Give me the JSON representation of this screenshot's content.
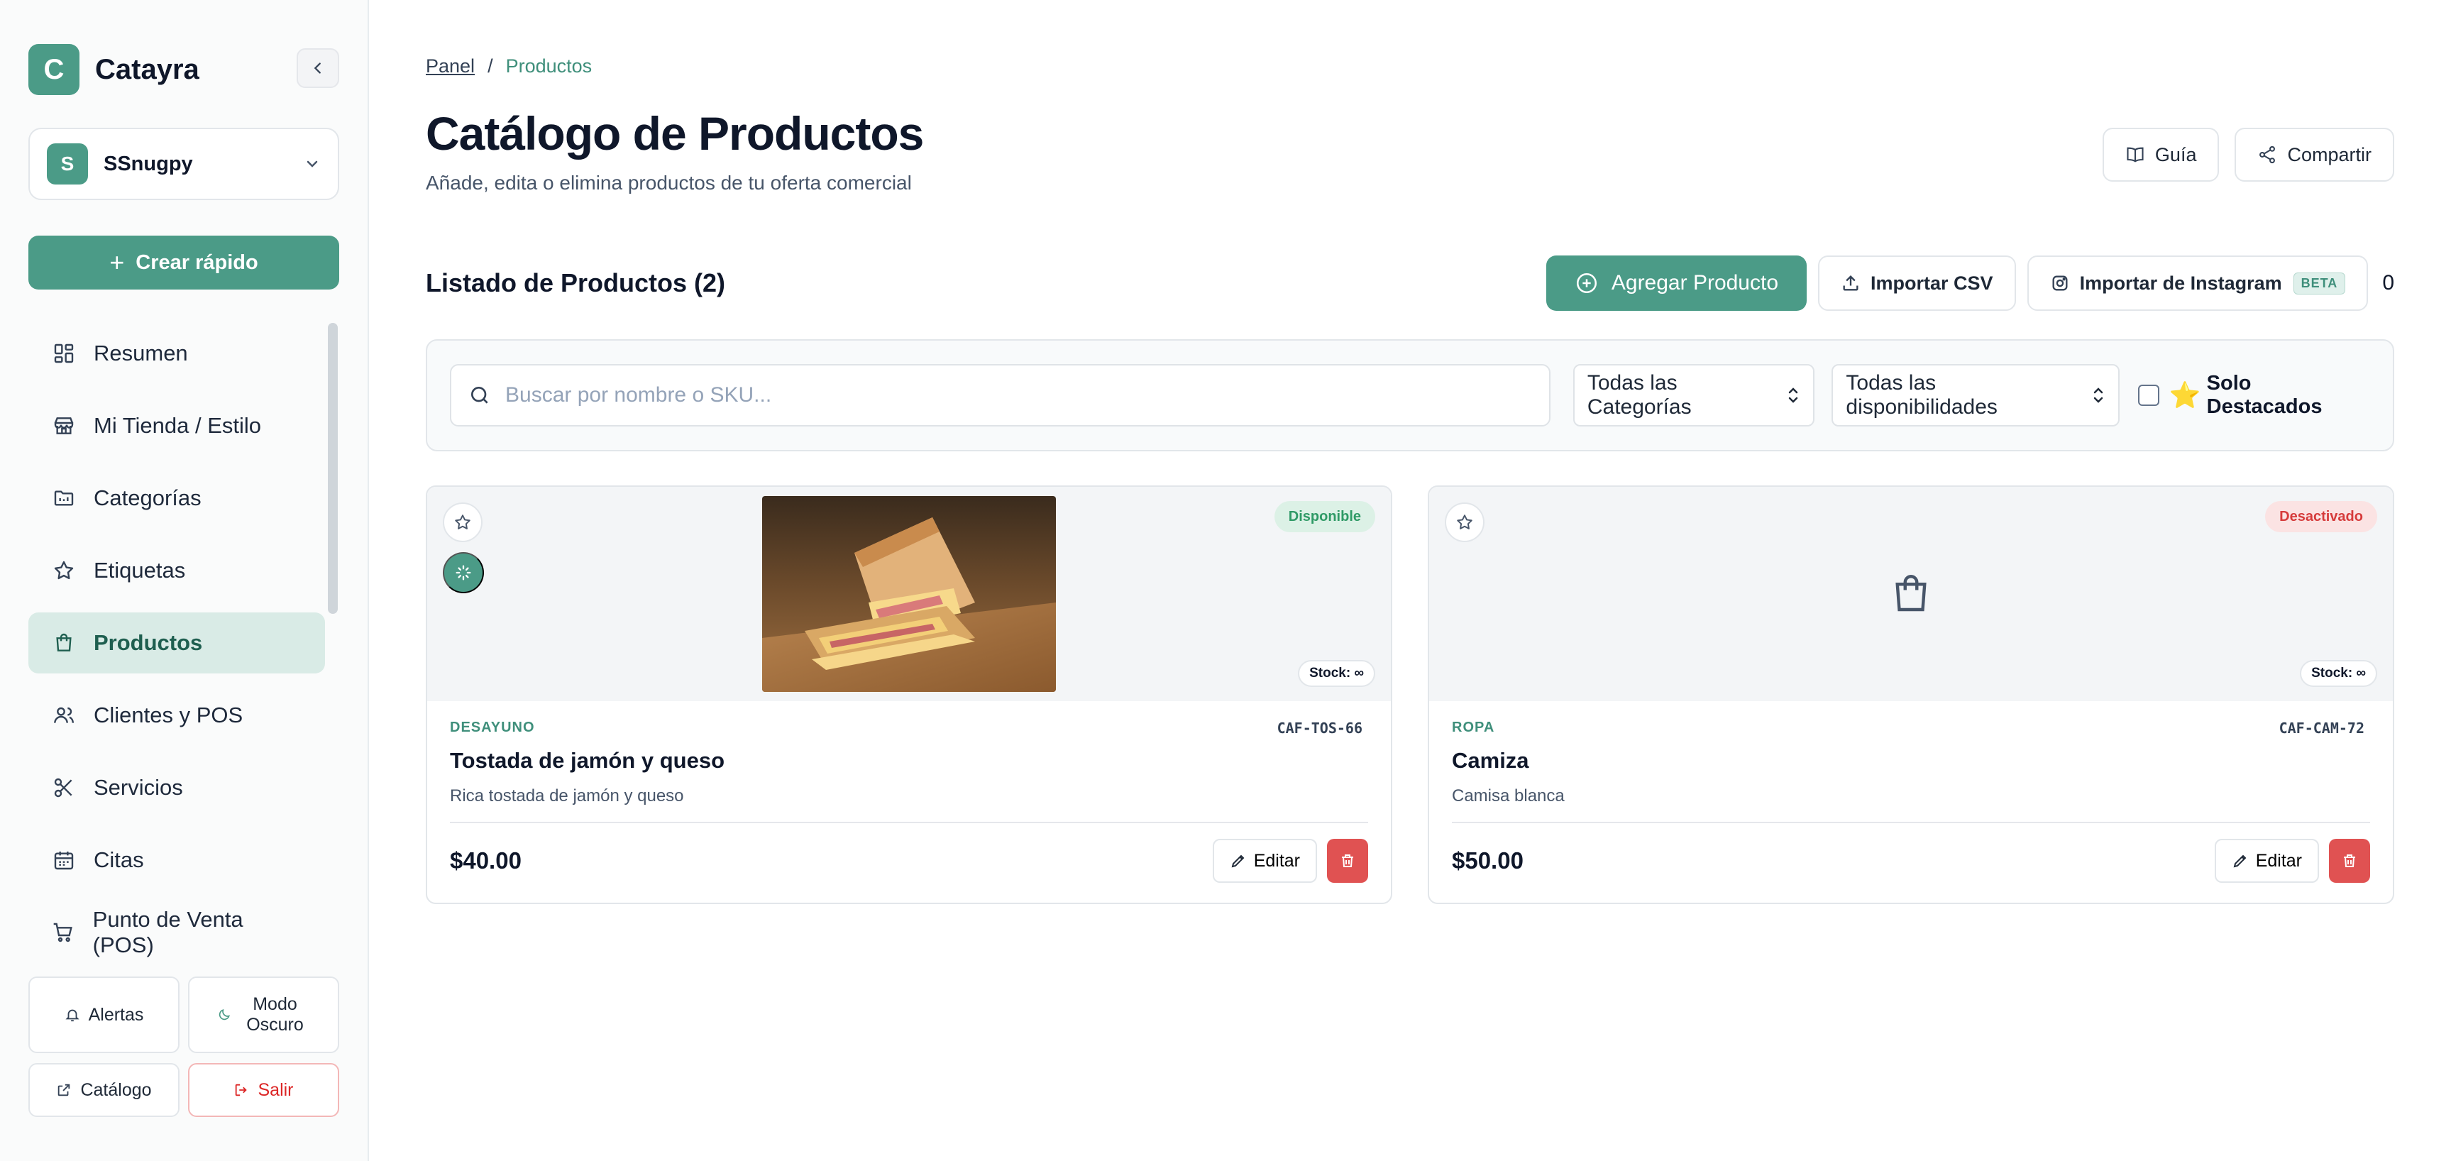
{
  "app": {
    "logo_letter": "C",
    "name": "Catayra"
  },
  "store": {
    "avatar_letter": "S",
    "name": "SSnugpy"
  },
  "sidebar": {
    "quick_create": "Crear rápido",
    "items": [
      {
        "label": "Resumen",
        "icon": "dashboard-grid-icon"
      },
      {
        "label": "Mi Tienda / Estilo",
        "icon": "store-icon"
      },
      {
        "label": "Categorías",
        "icon": "folder-icon"
      },
      {
        "label": "Etiquetas",
        "icon": "star-icon"
      },
      {
        "label": "Productos",
        "icon": "shopping-bag-icon",
        "active": true
      },
      {
        "label": "Clientes y POS",
        "icon": "users-icon"
      },
      {
        "label": "Servicios",
        "icon": "scissors-icon"
      },
      {
        "label": "Citas",
        "icon": "calendar-icon"
      },
      {
        "label": "Punto de Venta (POS)",
        "icon": "cart-icon"
      }
    ],
    "alerts": "Alertas",
    "dark_mode": "Modo Oscuro",
    "catalog": "Catálogo",
    "logout": "Salir"
  },
  "breadcrumb": {
    "root": "Panel",
    "separator": "/",
    "current": "Productos"
  },
  "header": {
    "title": "Catálogo de Productos",
    "subtitle": "Añade, edita o elimina productos de tu oferta comercial",
    "guide": "Guía",
    "share": "Compartir"
  },
  "list": {
    "title": "Listado de Productos (2)",
    "add": "Agregar Producto",
    "import_csv": "Importar CSV",
    "import_instagram": "Importar de Instagram",
    "beta": "BETA",
    "trailing": "0"
  },
  "filters": {
    "search_placeholder": "Buscar por nombre o SKU...",
    "category": "Todas las Categorías",
    "availability": "Todas las disponibilidades",
    "featured": "Solo Destacados",
    "featured_emoji": "⭐"
  },
  "products": [
    {
      "status": "Disponible",
      "stock": "Stock: ∞",
      "category": "DESAYUNO",
      "sku": "CAF-TOS-66",
      "name": "Tostada de jamón y queso",
      "description": "Rica tostada de jamón y queso",
      "price": "$40.00",
      "edit": "Editar"
    },
    {
      "status": "Desactivado",
      "stock": "Stock: ∞",
      "category": "ROPA",
      "sku": "CAF-CAM-72",
      "name": "Camiza",
      "description": "Camisa blanca",
      "price": "$50.00",
      "edit": "Editar"
    }
  ],
  "colors": {
    "accent": "#4b9b87",
    "danger": "#e05252",
    "available": "#2f9a66"
  }
}
